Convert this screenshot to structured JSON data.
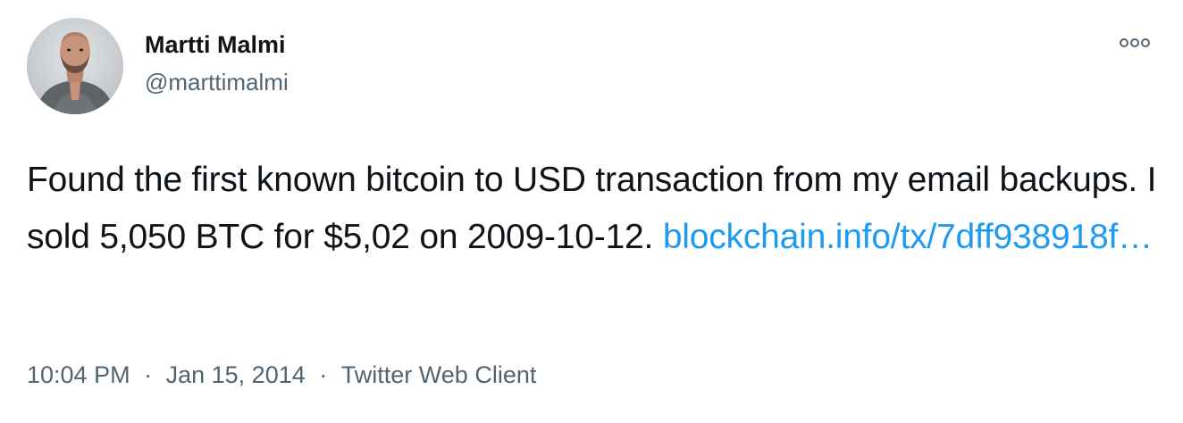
{
  "author": {
    "display_name": "Martti Malmi",
    "handle": "@marttimalmi",
    "avatar_icon": "person-avatar"
  },
  "tweet": {
    "text": "Found the first known bitcoin to USD transaction from my email backups. I sold 5,050 BTC for $5,02 on 2009-10-12.",
    "link_text": "blockchain.info/tx/7dff938918f…"
  },
  "meta": {
    "time": "10:04 PM",
    "date": "Jan 15, 2014",
    "client": "Twitter Web Client",
    "separator": "·"
  },
  "actions": {
    "more_icon": "more-options-icon"
  },
  "colors": {
    "text": "#0f1419",
    "secondary": "#536471",
    "link": "#1d9bf0"
  }
}
